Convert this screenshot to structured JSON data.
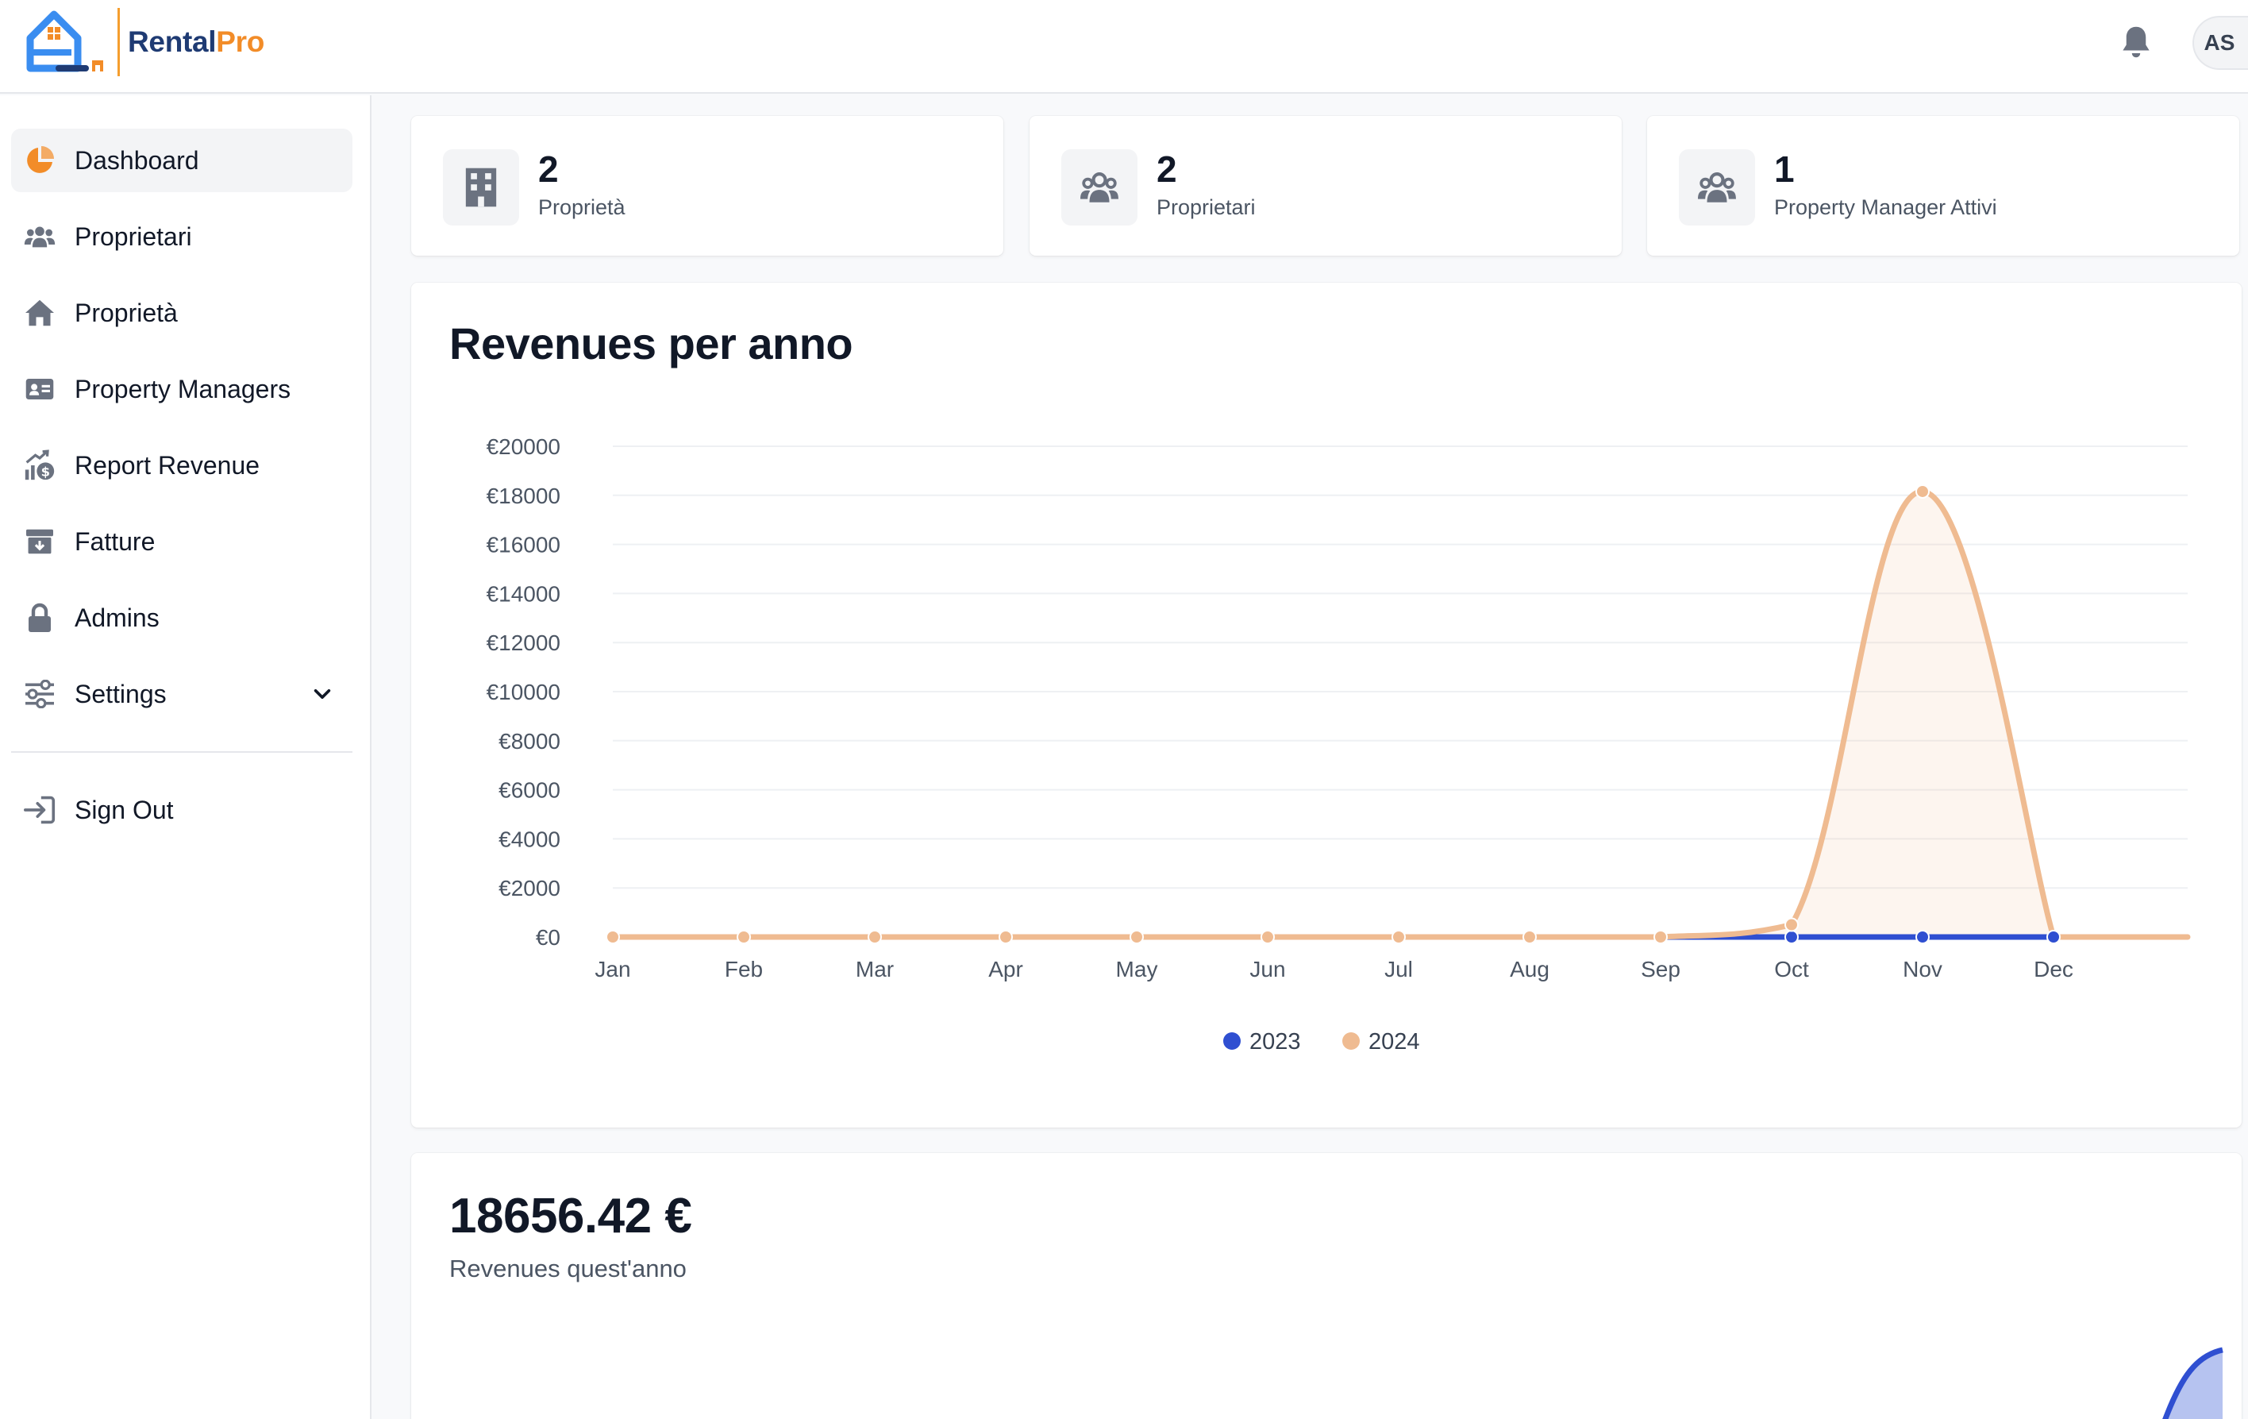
{
  "app": {
    "name_part1": "Rental",
    "name_part2": "Pro",
    "user_initials": "AS"
  },
  "sidebar": {
    "items": [
      {
        "label": "Dashboard",
        "icon": "pie-chart-icon",
        "active": true
      },
      {
        "label": "Proprietari",
        "icon": "users-icon"
      },
      {
        "label": "Proprietà",
        "icon": "home-icon"
      },
      {
        "label": "Property Managers",
        "icon": "id-card-icon"
      },
      {
        "label": "Report Revenue",
        "icon": "chart-money-icon"
      },
      {
        "label": "Fatture",
        "icon": "archive-icon"
      },
      {
        "label": "Admins",
        "icon": "lock-icon"
      },
      {
        "label": "Settings",
        "icon": "sliders-icon",
        "expandable": true
      }
    ],
    "signout": {
      "label": "Sign Out",
      "icon": "sign-in-icon"
    }
  },
  "stats": [
    {
      "value": "2",
      "label": "Proprietà",
      "icon": "building-icon"
    },
    {
      "value": "2",
      "label": "Proprietari",
      "icon": "users-icon"
    },
    {
      "value": "1",
      "label": "Property Manager Attivi",
      "icon": "users-icon"
    }
  ],
  "revenue_chart": {
    "title": "Revenues per anno"
  },
  "revenue_summary": {
    "value": "18656.42 €",
    "label": "Revenues quest'anno"
  },
  "colors": {
    "accent_orange": "#f28c28",
    "series_2023": "#2f4fd1",
    "series_2024": "#efbb91"
  },
  "chart_data": {
    "type": "area",
    "title": "Revenues per anno",
    "categories": [
      "Jan",
      "Feb",
      "Mar",
      "Apr",
      "May",
      "Jun",
      "Jul",
      "Aug",
      "Sep",
      "Oct",
      "Nov",
      "Dec"
    ],
    "y_ticks": [
      "€0",
      "€2000",
      "€4000",
      "€6000",
      "€8000",
      "€10000",
      "€12000",
      "€14000",
      "€16000",
      "€18000",
      "€20000"
    ],
    "ylim": [
      0,
      20000
    ],
    "series": [
      {
        "name": "2023",
        "color": "#2f4fd1",
        "values": [
          0,
          0,
          0,
          0,
          0,
          0,
          0,
          0,
          0,
          0,
          0,
          0
        ]
      },
      {
        "name": "2024",
        "color": "#efbb91",
        "values": [
          0,
          0,
          0,
          0,
          0,
          0,
          0,
          0,
          0,
          500,
          18156,
          0
        ]
      }
    ],
    "grid": true,
    "legend": "bottom-center"
  }
}
